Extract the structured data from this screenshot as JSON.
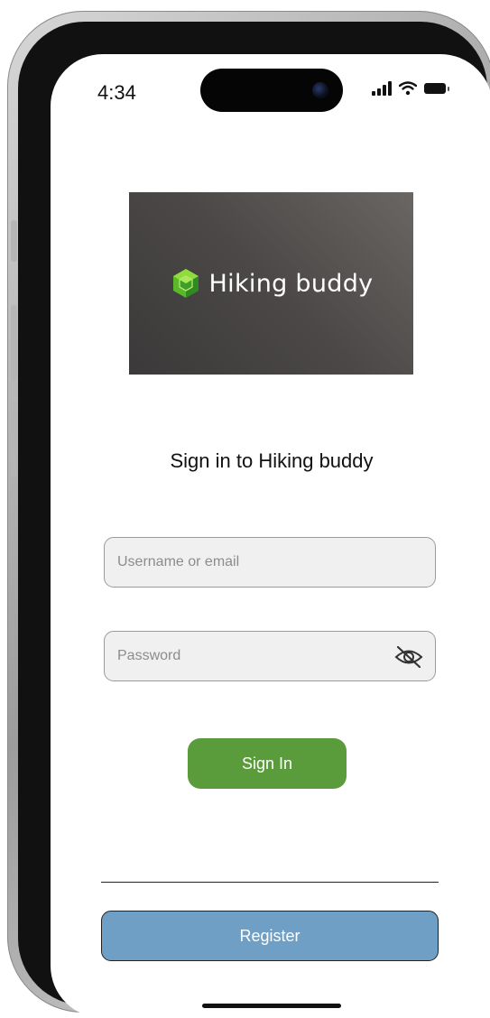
{
  "status_bar": {
    "time": "4:34",
    "icons": [
      "signal-icon",
      "wifi-icon",
      "battery-icon"
    ]
  },
  "banner": {
    "logo_text": "Hiking buddy",
    "logo_icon": "cube-logo-icon"
  },
  "title": "Sign in to Hiking buddy",
  "form": {
    "username_placeholder": "Username or email",
    "username_value": "",
    "password_placeholder": "Password",
    "password_value": "",
    "password_toggle_icon": "eye-off-icon"
  },
  "buttons": {
    "sign_in": "Sign In",
    "register": "Register"
  },
  "colors": {
    "accent_green": "#5a9b3b",
    "register_blue": "#6f9fc4",
    "banner_bg": "#4b4847"
  }
}
